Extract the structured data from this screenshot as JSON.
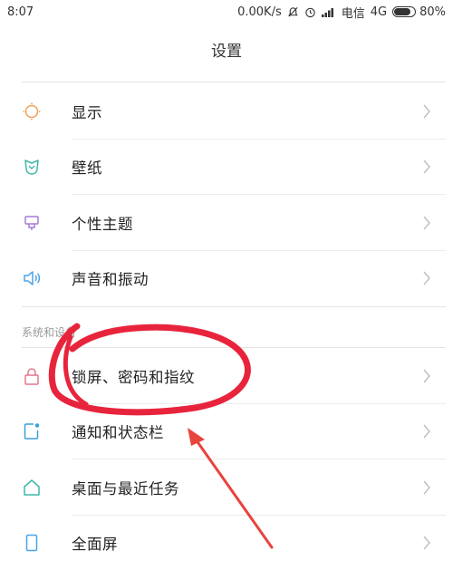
{
  "status_bar": {
    "time": "8:07",
    "speed": "0.00K/s",
    "carrier": "电信",
    "network": "4G",
    "battery": "80%",
    "battery_level": 0.8
  },
  "header": {
    "title": "设置"
  },
  "group1": [
    {
      "label": "显示",
      "icon": "brightness-icon",
      "color": "#f0a05a"
    },
    {
      "label": "壁纸",
      "icon": "wallpaper-icon",
      "color": "#3fb8a8"
    },
    {
      "label": "个性主题",
      "icon": "theme-icon",
      "color": "#a57bd8"
    },
    {
      "label": "声音和振动",
      "icon": "sound-icon",
      "color": "#4aa3e8"
    }
  ],
  "section": {
    "title": "系统和设备"
  },
  "group2": [
    {
      "label": "锁屏、密码和指纹",
      "icon": "lock-icon",
      "color": "#e07a8a"
    },
    {
      "label": "通知和状态栏",
      "icon": "notification-icon",
      "color": "#3aa0d8"
    },
    {
      "label": "桌面与最近任务",
      "icon": "home-icon",
      "color": "#3fb8a8"
    },
    {
      "label": "全面屏",
      "icon": "fullscreen-icon",
      "color": "#4aa3e8"
    }
  ],
  "annotation": {
    "circle_color": "#e8243c",
    "arrow_color": "#e8443c"
  }
}
